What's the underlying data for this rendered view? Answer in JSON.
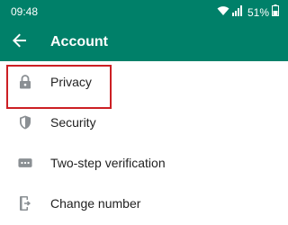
{
  "status_bar": {
    "time": "09:48",
    "battery_text": "51%",
    "icons": [
      "wifi-icon",
      "signal-icon",
      "battery-icon"
    ]
  },
  "app_bar": {
    "title": "Account",
    "back_icon": "arrow-left-icon",
    "background_color": "#008069"
  },
  "menu": {
    "items": [
      {
        "label": "Privacy",
        "icon": "lock-icon"
      },
      {
        "label": "Security",
        "icon": "shield-icon"
      },
      {
        "label": "Two-step verification",
        "icon": "dots-icon"
      },
      {
        "label": "Change number",
        "icon": "change-number-icon"
      }
    ]
  },
  "highlight": {
    "target": "Privacy",
    "color": "#cc1f24"
  }
}
